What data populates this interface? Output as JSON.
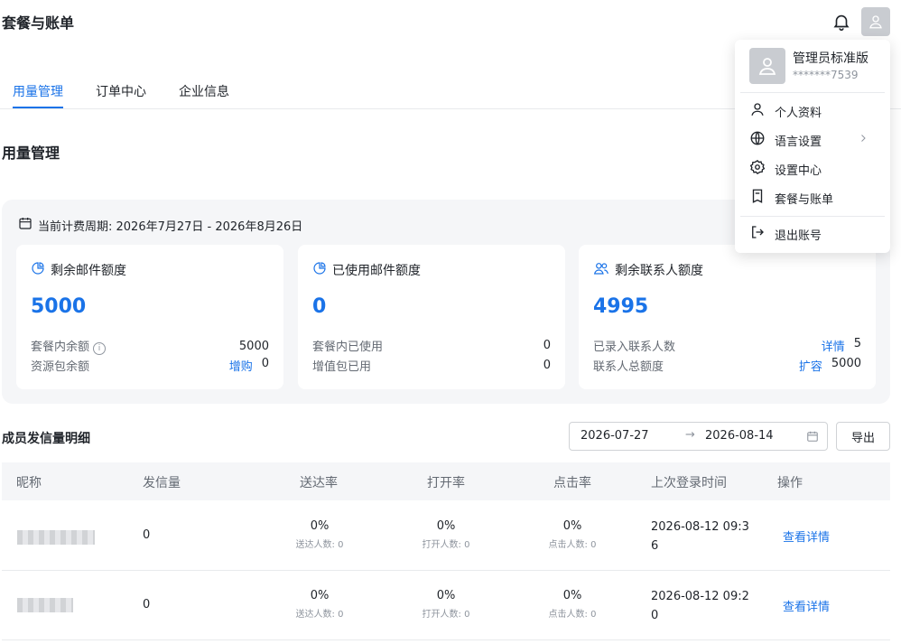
{
  "header": {
    "title": "套餐与账单"
  },
  "tabs": [
    {
      "label": "用量管理",
      "active": true
    },
    {
      "label": "订单中心",
      "active": false
    },
    {
      "label": "企业信息",
      "active": false
    }
  ],
  "section_title": "用量管理",
  "billing": {
    "cycle_label": "当前计费周期: 2026年7月27日 - 2026年8月26日",
    "cards": [
      {
        "title": "剩余邮件额度",
        "value": "5000",
        "rows": [
          {
            "label": "套餐内余额",
            "link": "",
            "value": "5000"
          },
          {
            "label": "资源包余额",
            "link": "增购",
            "value": "0"
          }
        ]
      },
      {
        "title": "已使用邮件额度",
        "value": "0",
        "rows": [
          {
            "label": "套餐内已使用",
            "link": "",
            "value": "0"
          },
          {
            "label": "增值包已用",
            "link": "",
            "value": "0"
          }
        ]
      },
      {
        "title": "剩余联系人额度",
        "value": "4995",
        "rows": [
          {
            "label": "已录入联系人数",
            "link": "详情",
            "value": "5"
          },
          {
            "label": "联系人总额度",
            "link": "扩容",
            "value": "5000"
          }
        ]
      }
    ]
  },
  "detail": {
    "title": "成员发信量明细",
    "date_start": "2026-07-27",
    "date_end": "2026-08-14",
    "arrow": "→",
    "export_label": "导出",
    "columns": [
      "昵称",
      "发信量",
      "送达率",
      "打开率",
      "点击率",
      "上次登录时间",
      "操作"
    ],
    "rows": [
      {
        "sent": "0",
        "delivery": "0%",
        "delivery_sub": "送达人数: 0",
        "open": "0%",
        "open_sub": "打开人数: 0",
        "click": "0%",
        "click_sub": "点击人数: 0",
        "last_login": "2026-08-12 09:36",
        "action": "查看详情"
      },
      {
        "sent": "0",
        "delivery": "0%",
        "delivery_sub": "送达人数: 0",
        "open": "0%",
        "open_sub": "打开人数: 0",
        "click": "0%",
        "click_sub": "点击人数: 0",
        "last_login": "2026-08-12 09:20",
        "action": "查看详情"
      }
    ]
  },
  "user_menu": {
    "name": "管理员标准版",
    "phone": "*******7539",
    "items": [
      {
        "label": "个人资料",
        "icon": "user-icon"
      },
      {
        "label": "语言设置",
        "icon": "globe-icon"
      },
      {
        "label": "设置中心",
        "icon": "gear-icon"
      },
      {
        "label": "套餐与账单",
        "icon": "receipt-icon"
      },
      {
        "label": "退出账号",
        "icon": "logout-icon"
      }
    ]
  },
  "colors": {
    "accent": "#1a73e8",
    "panel_bg": "#f5f6f8"
  }
}
